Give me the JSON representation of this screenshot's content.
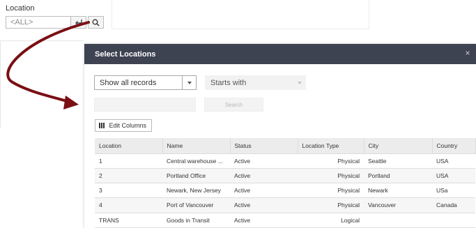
{
  "background_form": {
    "location_label": "Location",
    "location_value": "<ALL>"
  },
  "modal": {
    "title": "Select Locations",
    "close_symbol": "×",
    "filter": {
      "records_value": "Show all records",
      "match_value": "Starts with",
      "search_value": "",
      "search_button": "Search"
    },
    "edit_columns_label": "Edit Columns",
    "table": {
      "columns": [
        "Location",
        "Name",
        "Status",
        "Location Type",
        "City",
        "Country"
      ],
      "rows": [
        [
          "1",
          "Central warehouse ...",
          "Active",
          "Physical",
          "Seattle",
          "USA"
        ],
        [
          "2",
          "Portland Office",
          "Active",
          "Physical",
          "Portland",
          "USA"
        ],
        [
          "3",
          "Newark, New Jersey",
          "Active",
          "Physical",
          "Newark",
          "USa"
        ],
        [
          "4",
          "Port of Vancouver",
          "Active",
          "Physical",
          "Vancouver",
          "Canada"
        ],
        [
          "TRANS",
          "Goods in Transit",
          "Active",
          "Logical",
          "",
          ""
        ]
      ]
    }
  },
  "colors": {
    "header_bg": "#3d4351",
    "arrow": "#7a0f14"
  }
}
